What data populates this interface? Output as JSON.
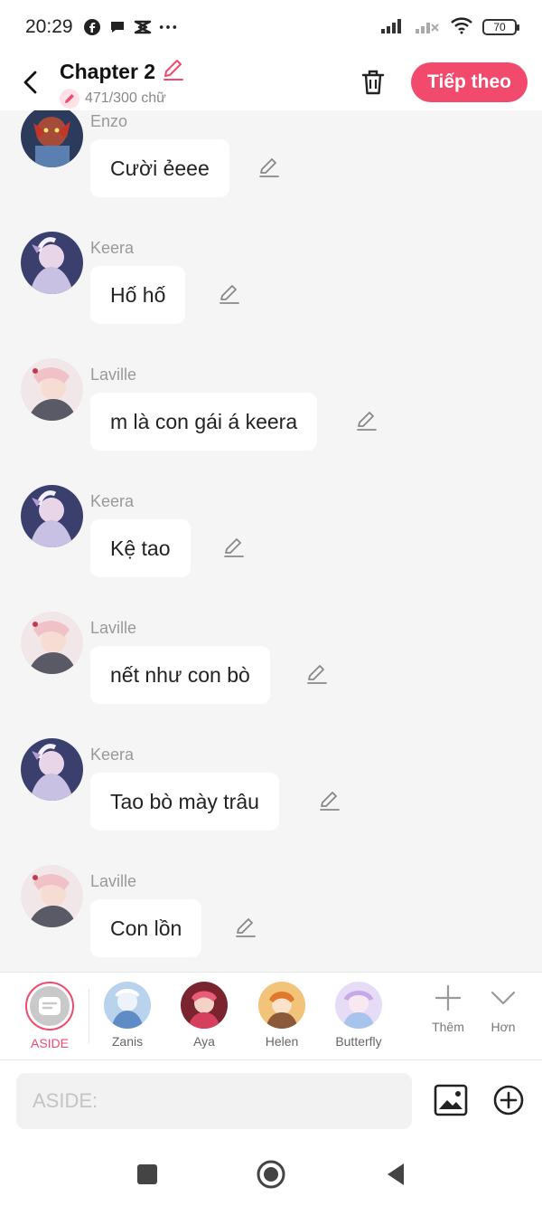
{
  "status_bar": {
    "time": "20:29",
    "icons": [
      "facebook-icon",
      "chat-bubble-icon",
      "capcut-icon",
      "more-dots-icon"
    ],
    "battery": "70"
  },
  "header": {
    "title": "Chapter 2",
    "word_count": "471/300 chữ",
    "next_label": "Tiếp theo",
    "accent_color": "#f24a6d"
  },
  "messages": [
    {
      "sender": "Enzo",
      "text": "Cười ẻeee"
    },
    {
      "sender": "Keera",
      "text": "Hố hố"
    },
    {
      "sender": "Laville",
      "text": "m là con gái á keera"
    },
    {
      "sender": "Keera",
      "text": "Kệ tao"
    },
    {
      "sender": "Laville",
      "text": "nết như con bò"
    },
    {
      "sender": "Keera",
      "text": "Tao bò mày trâu"
    },
    {
      "sender": "Laville",
      "text": "Con lồn"
    }
  ],
  "characters": [
    {
      "name": "ASIDE"
    },
    {
      "name": "Zanis"
    },
    {
      "name": "Aya"
    },
    {
      "name": "Helen"
    },
    {
      "name": "Butterfly"
    }
  ],
  "tools": {
    "add_label": "Thêm",
    "more_label": "Hơn"
  },
  "input": {
    "placeholder": "ASIDE:"
  }
}
